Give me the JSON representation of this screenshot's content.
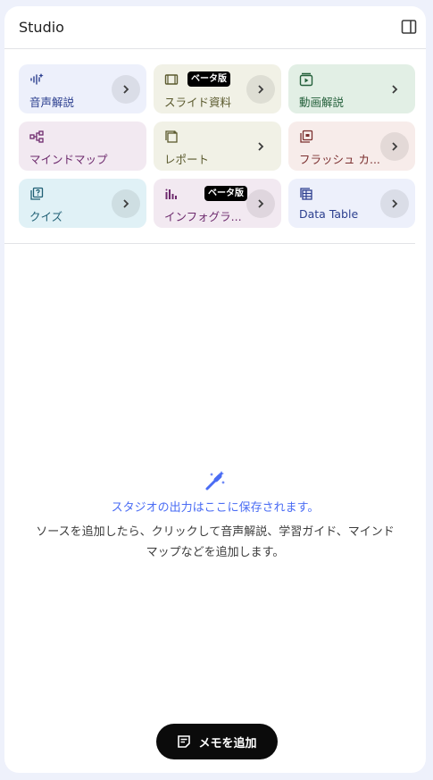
{
  "header": {
    "title": "Studio"
  },
  "tiles": [
    {
      "label": "音声解説",
      "bg": "#edf0fb",
      "fg": "#2c3f8f",
      "icon": "audio-waveform-icon",
      "badge": "",
      "arrow_bg": true
    },
    {
      "label": "スライド資料",
      "bg": "#f1f1e6",
      "fg": "#5b5a2e",
      "icon": "slides-icon",
      "badge": "ベータ版",
      "arrow_bg": true
    },
    {
      "label": "動画解説",
      "bg": "#e2efe5",
      "fg": "#24603b",
      "icon": "video-play-icon",
      "badge": "",
      "arrow_bg": false
    },
    {
      "label": "マインドマップ",
      "bg": "#f2e9f1",
      "fg": "#6d2a6d",
      "icon": "mind-map-icon",
      "badge": "",
      "arrow_bg": false
    },
    {
      "label": "レポート",
      "bg": "#f1f1e6",
      "fg": "#5b5a2e",
      "icon": "report-icon",
      "badge": "",
      "arrow_bg": false
    },
    {
      "label": "フラッシュ カ...",
      "bg": "#f7ecea",
      "fg": "#7b2f2f",
      "icon": "flashcards-icon",
      "badge": "",
      "arrow_bg": true
    },
    {
      "label": "クイズ",
      "bg": "#e0f1f6",
      "fg": "#1f5f74",
      "icon": "quiz-icon",
      "badge": "",
      "arrow_bg": true
    },
    {
      "label": "インフォグラ...",
      "bg": "#f2e9f1",
      "fg": "#6d2a6d",
      "icon": "infographic-icon",
      "badge": "ベータ版",
      "arrow_bg": true
    },
    {
      "label": "Data Table",
      "bg": "#edf0fb",
      "fg": "#2c3f8f",
      "icon": "data-table-icon",
      "badge": "",
      "arrow_bg": true
    }
  ],
  "empty_state": {
    "title": "スタジオの出力はここに保存されます。",
    "desc1": "ソースを追加したら、クリックして音声解説、学習ガイド、マインド",
    "desc2": "マップなどを追加します。"
  },
  "add_note": {
    "label": "メモを追加"
  }
}
